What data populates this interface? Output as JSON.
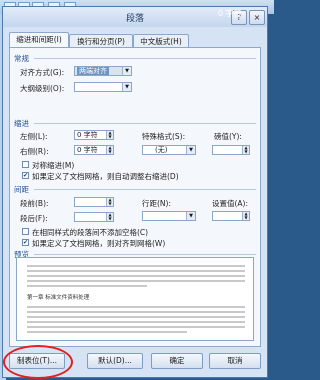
{
  "dialog": {
    "title": "段落",
    "help_button": "?",
    "close_button": "×",
    "top_right_text": "0 字符"
  },
  "tabs": [
    {
      "label": "缩进和间距(I)",
      "active": true
    },
    {
      "label": "换行和分页(P)",
      "active": false
    },
    {
      "label": "中文版式(H)",
      "active": false
    }
  ],
  "general": {
    "header": "常规",
    "alignment_label": "对齐方式(G):",
    "alignment_value": "两端对齐",
    "outline_label": "大纲级别(O):",
    "outline_value": ""
  },
  "indent": {
    "header": "缩进",
    "left_label": "左侧(L):",
    "left_value": "0 字符",
    "right_label": "右侧(R):",
    "right_value": "0 字符",
    "special_label": "特殊格式(S):",
    "special_value": "(无)",
    "by_label": "磅值(Y):",
    "by_value": "",
    "mirror_label": "对称缩进(M)",
    "auto_adjust_label": "如果定义了文档网格，则自动调整右缩进(D)"
  },
  "spacing": {
    "header": "间距",
    "before_label": "段前(B):",
    "before_value": "",
    "after_label": "段后(F):",
    "after_value": "",
    "line_label": "行距(N):",
    "line_value": "",
    "at_label": "设置值(A):",
    "at_value": "",
    "no_space_label": "在相同样式的段落间不添加空格(C)",
    "snap_grid_label": "如果定义了文档网格，则对齐到网格(W)"
  },
  "preview": {
    "header": "预览",
    "sample_text": "第一章 标准文件资料处理"
  },
  "buttons": {
    "tabs": "制表位(T)...",
    "default": "默认(D)...",
    "ok": "确定",
    "cancel": "取消"
  },
  "colors": {
    "accent": "#1f4f8f",
    "highlight_circle": "#e0211f"
  }
}
